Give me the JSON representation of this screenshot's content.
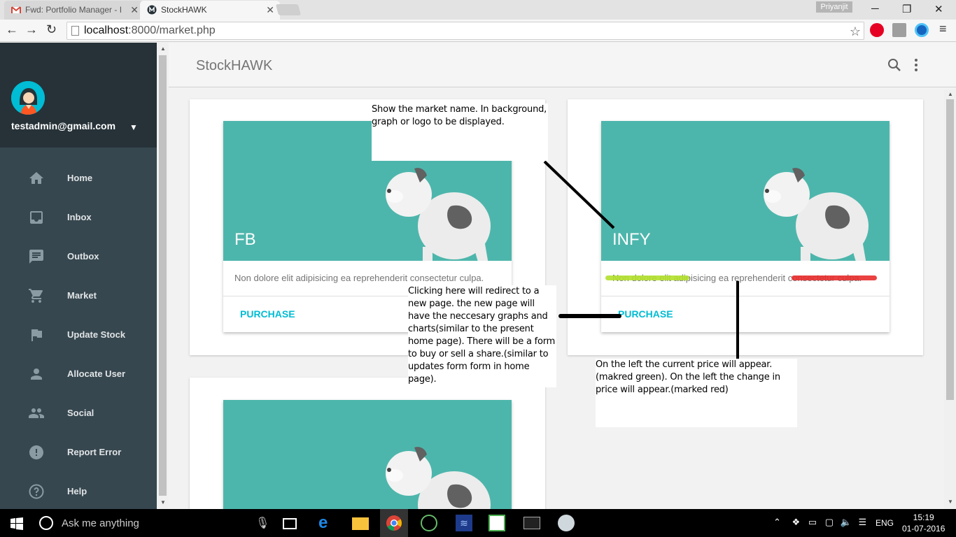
{
  "browser": {
    "tabs": [
      {
        "title": "Fwd: Portfolio Manager - I",
        "favicon": "gmail-icon"
      },
      {
        "title": "StockHAWK",
        "favicon": "stockhawk-icon"
      }
    ],
    "profile_name": "Priyanjit",
    "url_host": "localhost",
    "url_path": ":8000/market.php"
  },
  "sidebar": {
    "email": "testadmin@gmail.com",
    "items": [
      {
        "label": "Home",
        "icon": "home-icon"
      },
      {
        "label": "Inbox",
        "icon": "inbox-icon"
      },
      {
        "label": "Outbox",
        "icon": "outbox-icon"
      },
      {
        "label": "Market",
        "icon": "cart-icon"
      },
      {
        "label": "Update Stock",
        "icon": "flag-icon"
      },
      {
        "label": "Allocate User",
        "icon": "person-icon"
      },
      {
        "label": "Social",
        "icon": "people-icon"
      },
      {
        "label": "Report Error",
        "icon": "alert-icon"
      },
      {
        "label": "Help",
        "icon": "help-icon"
      }
    ]
  },
  "header": {
    "title": "StockHAWK"
  },
  "cards": [
    {
      "market": "FB",
      "description": "Non dolore elit adipisicing ea reprehenderit consectetur culpa.",
      "button": "PURCHASE"
    },
    {
      "market": "INFY",
      "description": "Non dolore elit adipisicing ea reprehenderit consectetur culpa.",
      "button": "PURCHASE"
    },
    {
      "market": "",
      "description": "",
      "button": ""
    }
  ],
  "annotations": {
    "market_note": "Show the market name. In background, graph or logo to be displayed.",
    "purchase_note": "Clicking here will redirect to a new page. the new page will have the neccesary graphs and charts(similar to the present home page). There will be a form to buy or sell a share.(similar to updates form form in home page).",
    "price_note": "On the left the current price will appear.(makred green). On the left the change in price will appear.(marked red)"
  },
  "taskbar": {
    "search_placeholder": "Ask me anything",
    "language": "ENG",
    "time": "15:19",
    "date": "01-07-2016"
  },
  "colors": {
    "accent": "#00bcd4",
    "card_media": "#4db6ac",
    "sidebar": "#37474f",
    "sidebar_header": "#263238"
  }
}
